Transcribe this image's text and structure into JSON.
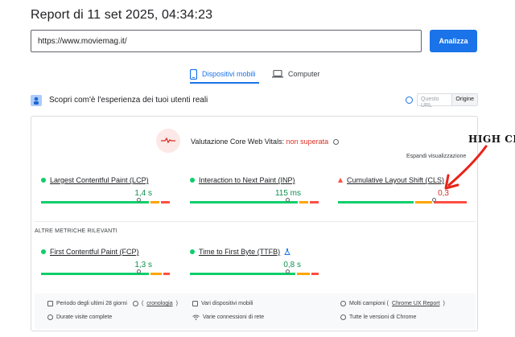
{
  "report": {
    "title": "Report di 11 set 2025, 04:34:23"
  },
  "search": {
    "url": "https://www.moviemag.it/",
    "analyze_label": "Analizza"
  },
  "tabs": [
    {
      "label": "Dispositivi mobili",
      "icon": "phone-icon",
      "active": true
    },
    {
      "label": "Computer",
      "icon": "laptop-icon",
      "active": false
    }
  ],
  "field": {
    "title": "Scopri com'è l'esperienza dei tuoi utenti reali",
    "toggle": {
      "off": "Questo URL",
      "on": "Origine"
    }
  },
  "cwv": {
    "label": "Valutazione Core Web Vitals:",
    "status": "non superata",
    "expand": "Espandi visualizzazione"
  },
  "metrics": [
    {
      "name": "Largest Contentful Paint (LCP)",
      "value": "1,4 s",
      "status": "good",
      "dist": [
        0.86,
        0.07,
        0.07
      ],
      "marker": 0.76
    },
    {
      "name": "Interaction to Next Paint (INP)",
      "value": "115 ms",
      "status": "good",
      "dist": [
        0.86,
        0.07,
        0.07
      ],
      "marker": 0.76
    },
    {
      "name": "Cumulative Layout Shift (CLS)",
      "value": "0,3",
      "status": "poor",
      "dist": [
        0.6,
        0.14,
        0.26
      ],
      "marker": 0.75
    }
  ],
  "other": {
    "title": "ALTRE METRICHE RILEVANTI",
    "metrics": [
      {
        "name": "First Contentful Paint (FCP)",
        "value": "1,3 s",
        "status": "good",
        "dist": [
          0.86,
          0.09,
          0.05
        ],
        "marker": 0.76
      },
      {
        "name": "Time to First Byte (TTFB)",
        "value": "0,8 s",
        "status": "good",
        "dist": [
          0.84,
          0.1,
          0.06
        ],
        "marker": 0.76
      }
    ]
  },
  "footer": {
    "period": "Periodo degli ultimi 28 giorni",
    "history": "cronologia",
    "devices": "Vari dispositivi mobili",
    "samples_prefix": "Molti campioni (",
    "samples_link": "Chrome UX Report",
    "samples_suffix": ")",
    "duration": "Durate visite complete",
    "connections": "Varie connessioni di rete",
    "versions": "Tutte le versioni di Chrome"
  },
  "annotation": {
    "text": "HIGH CLS"
  },
  "colors": {
    "good": "#0cce6b",
    "average": "#ffa400",
    "poor": "#ff4e42",
    "accent": "#1a73e8"
  }
}
